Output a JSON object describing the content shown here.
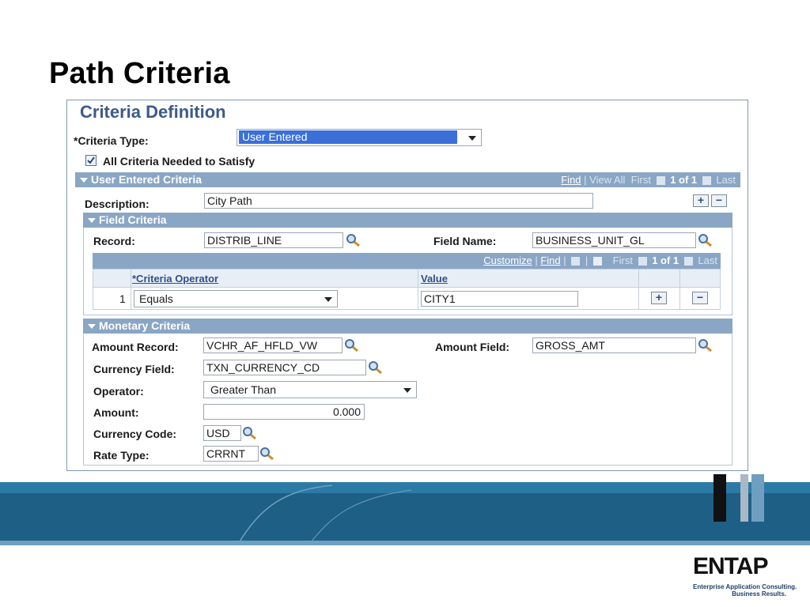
{
  "slide": {
    "title": "Path Criteria"
  },
  "panel": {
    "heading": "Criteria Definition",
    "criteria_type_label": "*Criteria Type:",
    "criteria_type_value": "User Entered",
    "all_criteria_label": "All Criteria Needed to Satisfy",
    "all_criteria_checked": true
  },
  "user_entered": {
    "title": "User Entered Criteria",
    "nav": {
      "find": "Find",
      "view_all": "View All",
      "first": "First",
      "count": "1 of 1",
      "last": "Last"
    },
    "description_label": "Description:",
    "description_value": "City Path"
  },
  "field_criteria": {
    "title": "Field Criteria",
    "record_label": "Record:",
    "record_value": "DISTRIB_LINE",
    "field_name_label": "Field Name:",
    "field_name_value": "BUSINESS_UNIT_GL",
    "grid_nav": {
      "customize": "Customize",
      "find": "Find",
      "first": "First",
      "count": "1 of 1",
      "last": "Last"
    },
    "columns": [
      "*Criteria Operator",
      "Value"
    ],
    "rows": [
      {
        "num": "1",
        "operator": "Equals",
        "value": "CITY1"
      }
    ]
  },
  "monetary": {
    "title": "Monetary Criteria",
    "amount_record_label": "Amount Record:",
    "amount_record_value": "VCHR_AF_HFLD_VW",
    "amount_field_label": "Amount Field:",
    "amount_field_value": "GROSS_AMT",
    "currency_field_label": "Currency Field:",
    "currency_field_value": "TXN_CURRENCY_CD",
    "operator_label": "Operator:",
    "operator_value": "Greater Than",
    "amount_label": "Amount:",
    "amount_value": "0.000",
    "currency_code_label": "Currency Code:",
    "currency_code_value": "USD",
    "rate_type_label": "Rate Type:",
    "rate_type_value": "CRRNT"
  },
  "logo": {
    "name": "ENTAP",
    "tagline1": "Enterprise Application Consulting.",
    "tagline2": "Business Results."
  },
  "colors": {
    "header_bar": "#8aa6c5",
    "heading": "#3c5a8a",
    "select_highlight": "#3a6fd8",
    "band": "#1e5f86"
  }
}
